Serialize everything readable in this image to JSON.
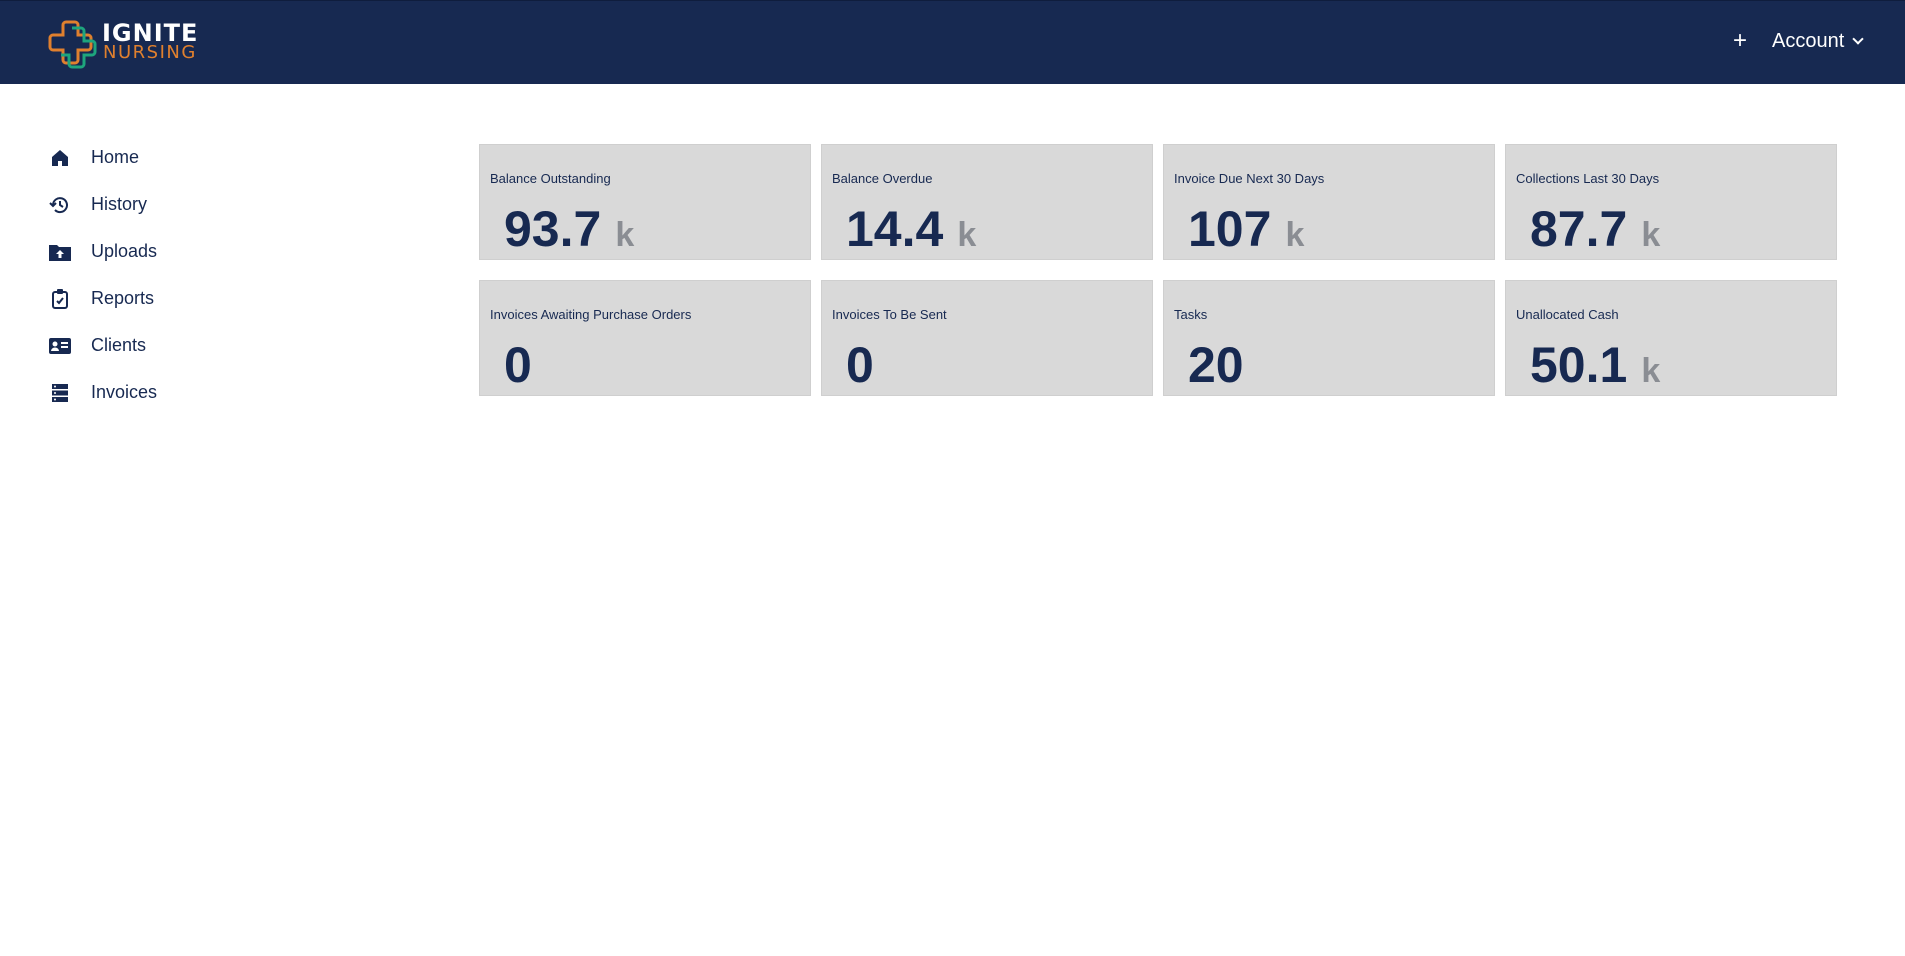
{
  "brand": {
    "word1": "IGNITE",
    "word2": "NURSING",
    "colors": {
      "navy": "#172951",
      "orange": "#e0802e",
      "green": "#1ea57d"
    }
  },
  "header": {
    "add_label": "+",
    "account_label": "Account"
  },
  "sidebar": {
    "items": [
      {
        "label": "Home",
        "icon": "home-icon"
      },
      {
        "label": "History",
        "icon": "history-icon"
      },
      {
        "label": "Uploads",
        "icon": "folder-upload-icon"
      },
      {
        "label": "Reports",
        "icon": "clipboard-icon"
      },
      {
        "label": "Clients",
        "icon": "id-card-icon"
      },
      {
        "label": "Invoices",
        "icon": "server-list-icon"
      }
    ]
  },
  "cards": [
    {
      "title": "Balance Outstanding",
      "value": "93.7",
      "unit": "k"
    },
    {
      "title": "Balance Overdue",
      "value": "14.4",
      "unit": "k"
    },
    {
      "title": "Invoice Due Next 30 Days",
      "value": "107",
      "unit": "k"
    },
    {
      "title": "Collections Last 30 Days",
      "value": "87.7",
      "unit": "k"
    },
    {
      "title": "Invoices Awaiting Purchase Orders",
      "value": "0",
      "unit": ""
    },
    {
      "title": "Invoices To Be Sent",
      "value": "0",
      "unit": ""
    },
    {
      "title": "Tasks",
      "value": "20",
      "unit": ""
    },
    {
      "title": "Unallocated Cash",
      "value": "50.1",
      "unit": "k"
    }
  ]
}
